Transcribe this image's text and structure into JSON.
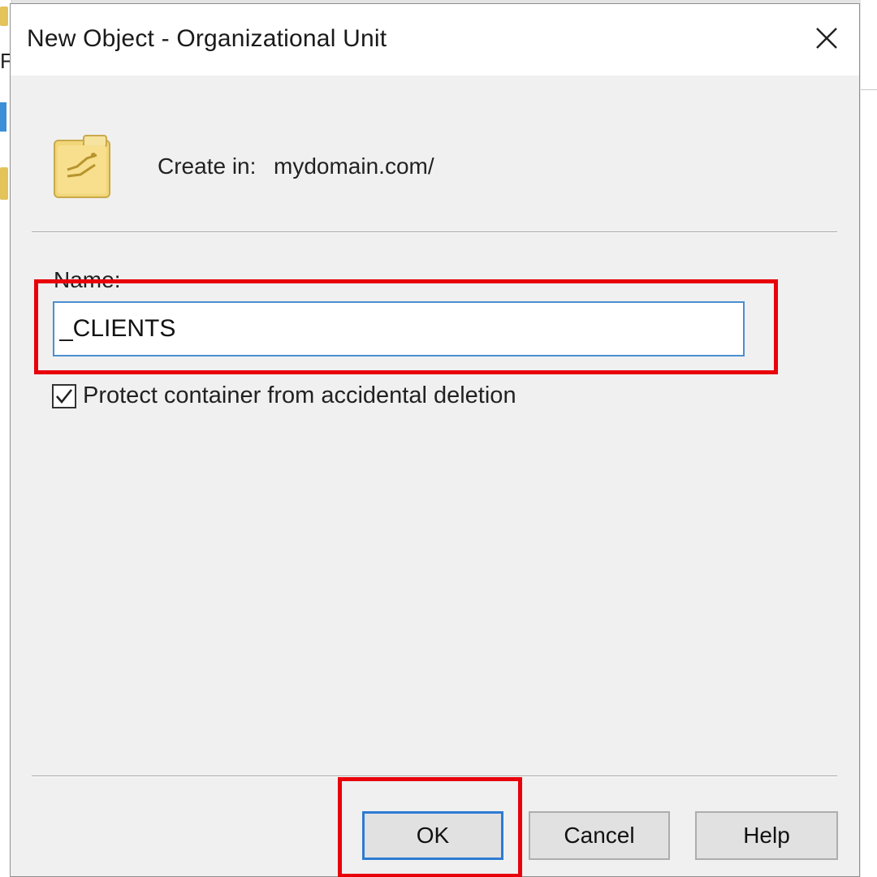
{
  "dialog": {
    "title": "New Object - Organizational Unit",
    "create_in_label": "Create in:",
    "create_in_value": "mydomain.com/",
    "name_label": "Name:",
    "name_value": "_CLIENTS",
    "protect_label": "Protect container from accidental deletion",
    "protect_checked": true
  },
  "buttons": {
    "ok": "OK",
    "cancel": "Cancel",
    "help": "Help"
  },
  "icons": {
    "close": "close-icon",
    "folder": "ou-folder-icon",
    "check": "checkmark-icon"
  },
  "colors": {
    "highlight": "#e8000b",
    "focus_border": "#2d7bd2",
    "folder": "#f2d67a"
  }
}
